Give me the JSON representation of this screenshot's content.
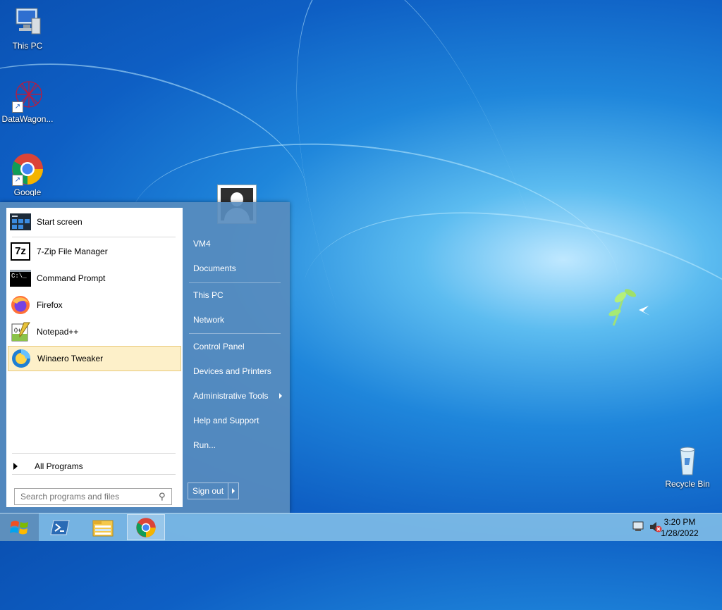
{
  "desktop": {
    "icons": [
      {
        "label": "This PC"
      },
      {
        "label": "DataWagon..."
      },
      {
        "label": "Google Chrome"
      },
      {
        "label": "Recycle Bin"
      }
    ]
  },
  "start_menu": {
    "programs": [
      {
        "label": "Start screen",
        "icon": "start-screen-icon"
      },
      {
        "label": "7-Zip File Manager",
        "icon": "7zip-icon",
        "icon_text": "7z"
      },
      {
        "label": "Command Prompt",
        "icon": "command-prompt-icon",
        "icon_text": "C:\\_"
      },
      {
        "label": "Firefox",
        "icon": "firefox-icon"
      },
      {
        "label": "Notepad++",
        "icon": "notepad-plus-plus-icon"
      },
      {
        "label": "Winaero Tweaker",
        "icon": "winaero-tweaker-icon"
      }
    ],
    "all_programs": "All Programs",
    "search": {
      "placeholder": "Search programs and files",
      "value": ""
    },
    "right_items": [
      {
        "label": "VM4"
      },
      {
        "label": "Documents"
      },
      {
        "label": "This PC"
      },
      {
        "label": "Network"
      },
      {
        "label": "Control Panel"
      },
      {
        "label": "Devices and Printers"
      },
      {
        "label": "Administrative Tools",
        "has_submenu": true
      },
      {
        "label": "Help and Support"
      },
      {
        "label": "Run..."
      }
    ],
    "sign_out": "Sign out"
  },
  "taskbar": {
    "pinned": [
      {
        "icon": "powershell-icon"
      },
      {
        "icon": "file-explorer-icon"
      },
      {
        "icon": "chrome-icon"
      }
    ],
    "clock": {
      "time": "3:20 PM",
      "date": "1/28/2022"
    }
  },
  "colors": {
    "accent": "#588cbe",
    "highlight": "#fdf0c9",
    "taskbar": "#84c0e8"
  }
}
